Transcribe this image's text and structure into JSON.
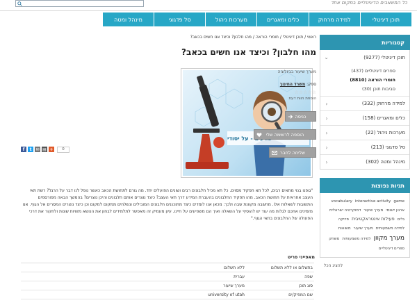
{
  "header": {
    "search": {
      "placeholder": ""
    },
    "tagline": "כל המשאבים הדיגיטליים במקום אחד"
  },
  "nav": {
    "items": [
      "תוכן דיגיטלי",
      "למידה מרחוק",
      "כלים ומאגרים",
      "מערכות ניהול",
      "סל פדגוגי",
      "מינהל ומטה"
    ]
  },
  "sidebar": {
    "categories_title": "קטגוריות",
    "categories": [
      {
        "label": "תוכן דיגיטלי (9277)",
        "expanded": true
      },
      {
        "label": "למידה מרחוק (332)",
        "expanded": false
      },
      {
        "label": "כלים ומאגרים (158)",
        "expanded": false
      },
      {
        "label": "מערכות ניהול (22)",
        "expanded": false
      },
      {
        "label": "סל פדגוגי (213)",
        "expanded": false
      },
      {
        "label": "מינהל ומטה (302)",
        "expanded": false
      }
    ],
    "subcategories": [
      {
        "label": "ספרים דיגיטליים (437)",
        "active": false
      },
      {
        "label": "חומרי הוראה (8810)",
        "active": true
      },
      {
        "label": "סביבות תוכן (30)",
        "active": false
      }
    ],
    "tags_title": "תגיות נפוצות",
    "tags": [
      {
        "text": "game",
        "size": "sm"
      },
      {
        "text": "interactive activity",
        "size": "sm"
      },
      {
        "text": "vocabulary",
        "size": "sm"
      },
      {
        "text": "ארגון יישומי",
        "size": "sm"
      },
      {
        "text": "מערך שיעור",
        "size": "sm"
      },
      {
        "text": "דמוקרטיה ישראלית",
        "size": "sm"
      },
      {
        "text": "גלים",
        "size": "sm"
      },
      {
        "text": "פעילות אינטראקטיבית",
        "size": "md"
      },
      {
        "text": "פיזיקה",
        "size": "sm"
      },
      {
        "text": "למידה משמעותית",
        "size": "sm"
      },
      {
        "text": "מערך שיעור",
        "size": "sm"
      },
      {
        "text": "משואות",
        "size": "sm"
      },
      {
        "text": "מערך מקוון",
        "size": "lg"
      },
      {
        "text": "למידה משמעותית",
        "size": "sm"
      },
      {
        "text": "משחק",
        "size": "sm"
      },
      {
        "text": "ספרים דיגיטליים",
        "size": "sm"
      }
    ],
    "all_tags_label": "להציג הכל"
  },
  "breadcrumb": "ראשי / תוכן דיגיטלי / חומרי הוראה / מהו חלבון? וכיצד אנו חשים בכאב?",
  "page_title": "מהו חלבון? וכיצד אנו חשים בכאב?",
  "hero": {
    "caption": "מדעים - על יסודי"
  },
  "meta": {
    "editor": "מערך שיעור בביולוגיה",
    "publisher_label": "ספק:",
    "publisher_value": "משרד החינוך",
    "stars": "☆☆☆☆☆",
    "add_review": "הוספת חוות דעת"
  },
  "actions": {
    "enter_label": "כניסה",
    "add_to_list_label": "הוספה לרשימה שלי",
    "send_friend_label": "שליחה לחבר"
  },
  "share": {
    "count": "0"
  },
  "description": "\"גופנו בנוי מתאים רבים, לכל תא תפקיד מסוים. כל תא מכיל חלבונים רבים ושונים הפועלים יחד. מה גורם לתחושת הכאב כאשר נופל לנו דבר על הרגל? רשת תאי העצב אחראית על תחושת הכאב. מהו תפקיד החלבונים בהעברת המידע דרך תאי העצב? כיצד נוצרים אותם חלבונים והיכן נוצרים? בהמשך הבאה מפורסמים התשובות לשאלות אלו. מחשבה מקוונת שבה ולכך: מכאן אנו לומדים כיצד מתוכננים חלבונים המובילים ונשלחים ממקום למקום וכן כיצד נוצרים המסרים אל הגוף. אנו מזמינים אתכם לגלות מה עוד יש להוסיף על השאלה ואיך הם משפיעים על חיינו. עיון מעמיק זה מאפשר לתלמידים לבחון את הנושא מזוויות שונות ולחקור את דרכי הפעולה של החלבונים בתאי הגוף.\"",
  "properties": {
    "title": "מאפייני פריט",
    "rows": [
      {
        "k1": "בתשלום או ללא תשלום",
        "v1": "ללא תשלום",
        "k2": "",
        "v2": ""
      },
      {
        "k1": "שפה",
        "v1": "עברית",
        "k2": "",
        "v2": ""
      },
      {
        "k1": "סוג תוכן",
        "v1": "מערך שיעור",
        "k2": "",
        "v2": ""
      },
      {
        "k1": "שם המפיק/ים",
        "v1": "university of utah",
        "k2": "",
        "v2": ""
      }
    ]
  }
}
